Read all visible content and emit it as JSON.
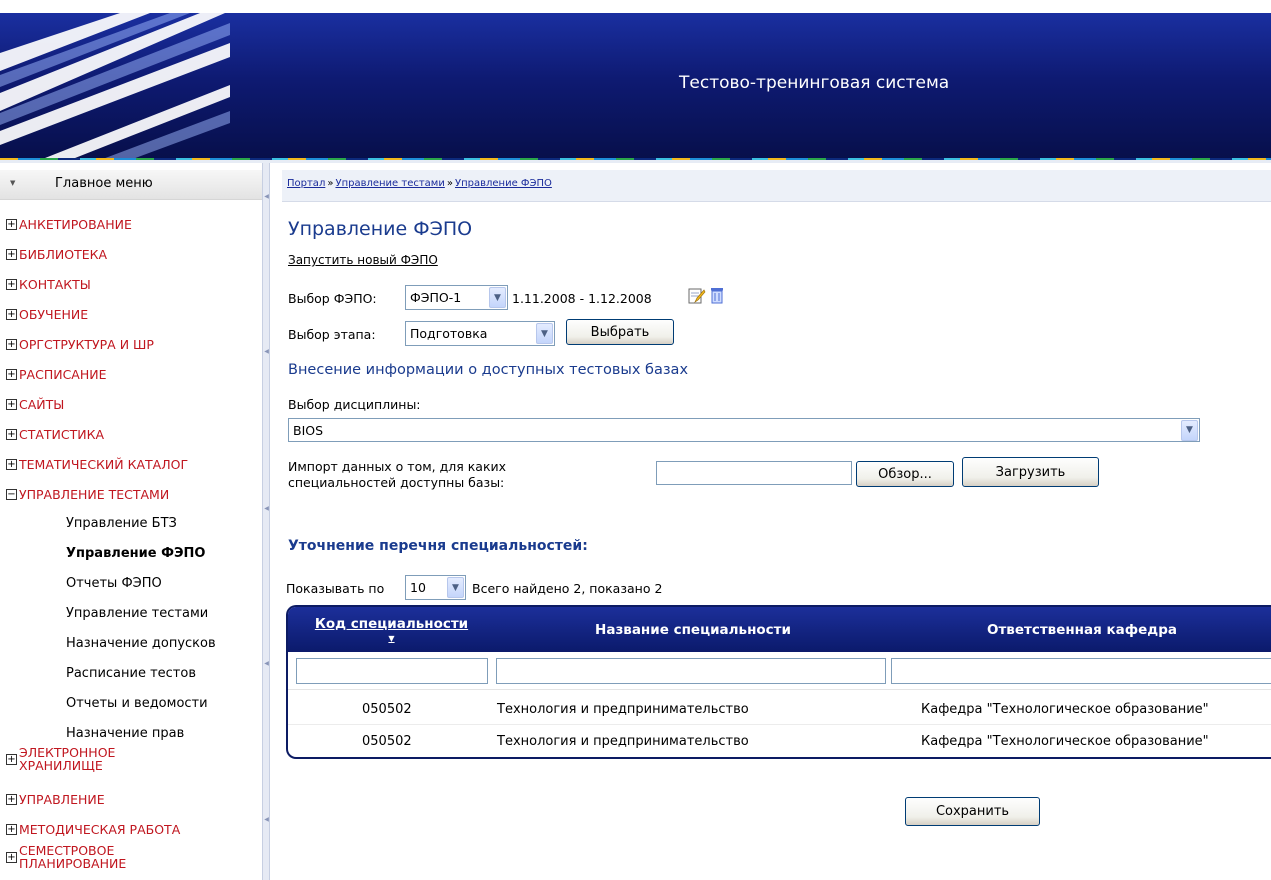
{
  "header": {
    "title": "Тестово-тренинговая система"
  },
  "sidebar": {
    "menu_title": "Главное меню",
    "items": [
      {
        "label": "АНКЕТИРОВАНИЕ"
      },
      {
        "label": "БИБЛИОТЕКА"
      },
      {
        "label": "КОНТАКТЫ"
      },
      {
        "label": "ОБУЧЕНИЕ"
      },
      {
        "label": "ОРГСТРУКТУРА И ШР"
      },
      {
        "label": "РАСПИСАНИЕ"
      },
      {
        "label": "САЙТЫ"
      },
      {
        "label": "СТАТИСТИКА"
      },
      {
        "label": "ТЕМАТИЧЕСКИЙ КАТАЛОГ"
      },
      {
        "label": "УПРАВЛЕНИЕ ТЕСТАМИ"
      },
      {
        "label_line1": "ЭЛЕКТРОННОЕ",
        "label_line2": "ХРАНИЛИЩЕ"
      },
      {
        "label": "УПРАВЛЕНИЕ"
      },
      {
        "label": "МЕТОДИЧЕСКАЯ РАБОТА"
      },
      {
        "label_line1": "СЕМЕСТРОВОЕ",
        "label_line2": "ПЛАНИРОВАНИЕ"
      }
    ],
    "expand_symbol": "+",
    "collapse_symbol": "−",
    "subitems": [
      {
        "label": "Управление БТЗ"
      },
      {
        "label": "Управление ФЭПО",
        "active": true
      },
      {
        "label": "Отчеты ФЭПО"
      },
      {
        "label": "Управление тестами"
      },
      {
        "label": "Назначение допусков"
      },
      {
        "label": "Расписание тестов"
      },
      {
        "label": "Отчеты и ведомости"
      },
      {
        "label": "Назначение прав"
      }
    ]
  },
  "breadcrumb": {
    "items": [
      "Портал",
      "Управление тестами",
      "Управление ФЭПО"
    ],
    "separator": "»"
  },
  "main": {
    "title": "Управление ФЭПО",
    "new_fepo_link": "Запустить новый ФЭПО",
    "fepo_label": "Выбор ФЭПО:",
    "fepo_value": "ФЭПО-1",
    "fepo_dates": "1.11.2008 - 1.12.2008",
    "stage_label": "Выбор этапа:",
    "stage_value": "Подготовка",
    "select_button": "Выбрать",
    "section1_title": "Внесение информации о доступных тестовых базах",
    "discipline_label": "Выбор дисциплины:",
    "discipline_value": "BIOS",
    "import_label_line1": "Импорт данных о том, для каких",
    "import_label_line2": "специальностей доступны базы:",
    "browse_button": "Обзор...",
    "upload_button": "Загрузить",
    "section2_title": "Уточнение перечня специальностей:",
    "show_label": "Показывать по",
    "page_size": "10",
    "found_text": "Всего найдено 2, показано 2",
    "save_button": "Сохранить"
  },
  "table": {
    "columns": [
      "Код специальности",
      "Название специальности",
      "Ответственная кафедра"
    ],
    "rows": [
      {
        "code": "050502",
        "name": "Технология и предпринимательство",
        "dept": "Кафедра \"Технологическое образование\""
      },
      {
        "code": "050502",
        "name": "Технология и предпринимательство",
        "dept": "Кафедра \"Технологическое образование\""
      }
    ]
  },
  "icons": {
    "dropdown_arrow": "chevron-down-icon",
    "edit": "edit-icon",
    "delete": "trash-icon",
    "sort": "sort-desc-icon"
  },
  "colors": {
    "header_bg": "#0e1a72",
    "menu_item": "#c0161f",
    "title": "#1a3b8e",
    "table_head": "#0b1a6b",
    "link": "#1a2b9b"
  }
}
